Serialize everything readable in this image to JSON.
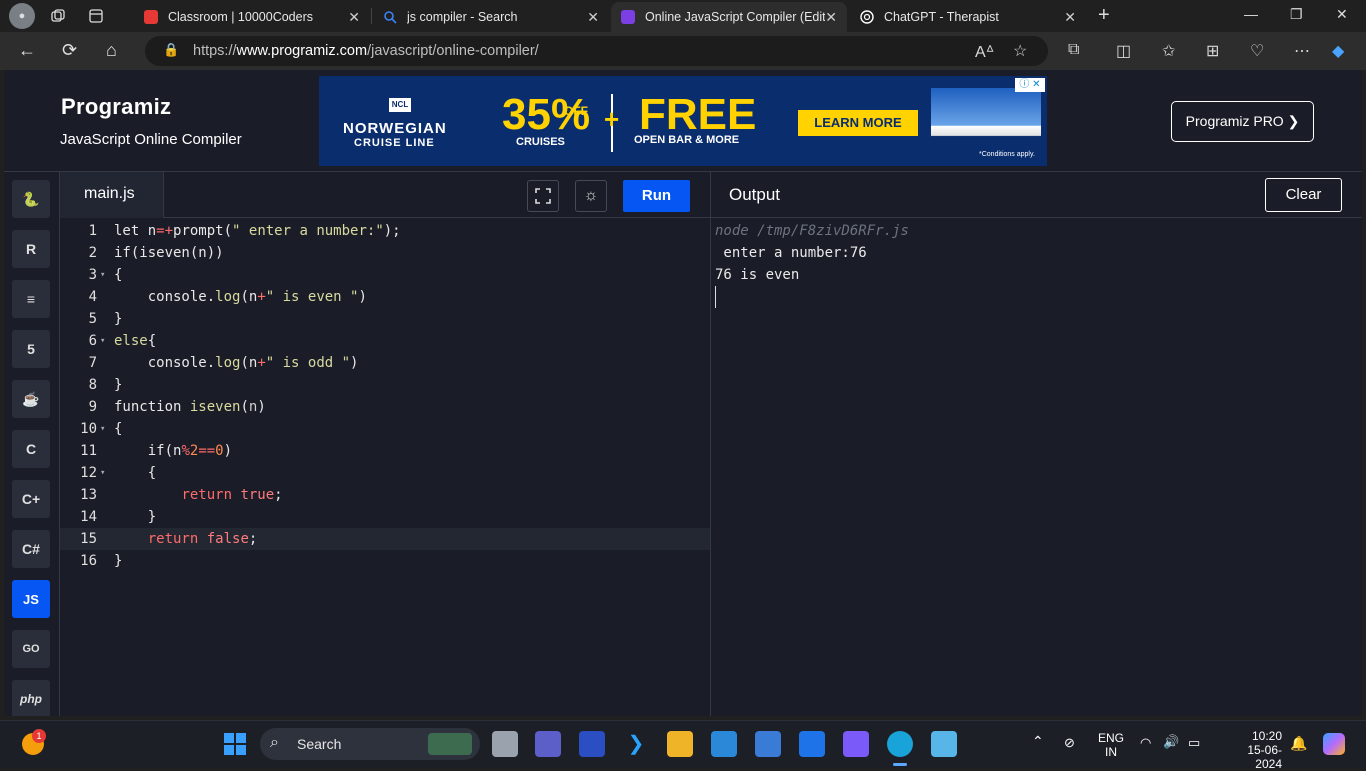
{
  "browser": {
    "tabs": [
      {
        "title": "Classroom | 10000Coders",
        "favicon_color": "#e53935"
      },
      {
        "title": "js compiler - Search",
        "favicon_color": "#3b82f6"
      },
      {
        "title": "Online JavaScript Compiler (Edito",
        "favicon_color": "#7b3fe4"
      },
      {
        "title": "ChatGPT - Therapist",
        "favicon_color": "#ffffff"
      }
    ],
    "close_glyph": "✕",
    "new_tab_glyph": "+",
    "url_prefix": "https://",
    "url_domain": "www.programiz.com",
    "url_path": "/javascript/online-compiler/"
  },
  "header": {
    "logo": "Programiz",
    "subtitle": "JavaScript Online Compiler",
    "pro_button": "Programiz PRO ❯"
  },
  "ad": {
    "ncl": "NCL",
    "brand_line1": "NORWEGIAN",
    "brand_line2": "CRUISE LINE",
    "percent": "35%",
    "off": "OFF",
    "cruises": "CRUISES",
    "plus": "+",
    "free": "FREE",
    "open_bar": "OPEN BAR & MORE",
    "cta": "LEARN MORE",
    "conditions": "*Conditions apply."
  },
  "sidebar": {
    "languages": [
      {
        "label": "🐍",
        "name": "python"
      },
      {
        "label": "R",
        "name": "r"
      },
      {
        "label": "≡",
        "name": "sql"
      },
      {
        "label": "5",
        "name": "html"
      },
      {
        "label": "☕",
        "name": "java"
      },
      {
        "label": "C",
        "name": "c"
      },
      {
        "label": "C+",
        "name": "cpp"
      },
      {
        "label": "C#",
        "name": "csharp"
      },
      {
        "label": "JS",
        "name": "javascript"
      },
      {
        "label": "GO",
        "name": "go"
      },
      {
        "label": "php",
        "name": "php"
      }
    ],
    "active": "javascript"
  },
  "editor": {
    "filename": "main.js",
    "run_label": "Run",
    "line_numbers": [
      "1",
      "2",
      "3",
      "4",
      "5",
      "6",
      "7",
      "8",
      "9",
      "10",
      "11",
      "12",
      "13",
      "14",
      "15",
      "16"
    ]
  },
  "output": {
    "title": "Output",
    "clear_label": "Clear",
    "command": "node /tmp/F8zivD6RFr.js",
    "lines": [
      " enter a number:76",
      "76 is even"
    ]
  },
  "taskbar": {
    "search_label": "Search",
    "lang1": "ENG",
    "lang2": "IN",
    "time": "10:20",
    "date": "15-06-2024",
    "notification_count": "1"
  }
}
